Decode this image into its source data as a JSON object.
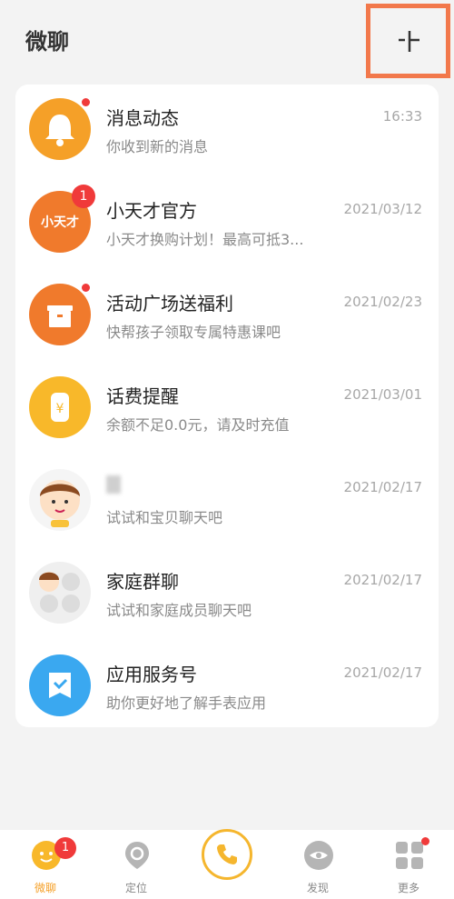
{
  "header": {
    "title": "微聊"
  },
  "messages": [
    {
      "name": "消息动态",
      "sub": "你收到新的消息",
      "time": "16:33",
      "icon": "bell-icon"
    },
    {
      "name": "小天才官方",
      "sub": "小天才换购计划！最高可抵3...",
      "time": "2021/03/12",
      "badge": "1",
      "avatar_text": "小天才",
      "icon": "xiaotiancai-logo"
    },
    {
      "name": "活动广场送福利",
      "sub": "快帮孩子领取专属特惠课吧",
      "time": "2021/02/23",
      "icon": "gift-icon"
    },
    {
      "name": "话费提醒",
      "sub": "余额不足0.0元，请及时充值",
      "time": "2021/03/01",
      "icon": "yuan-icon"
    },
    {
      "name": "",
      "sub": "试试和宝贝聊天吧",
      "time": "2021/02/17",
      "icon": "child-avatar"
    },
    {
      "name": "家庭群聊",
      "sub": "试试和家庭成员聊天吧",
      "time": "2021/02/17",
      "icon": "group-avatar"
    },
    {
      "name": "应用服务号",
      "sub": "助你更好地了解手表应用",
      "time": "2021/02/17",
      "icon": "service-icon"
    }
  ],
  "tabbar": {
    "tabs": [
      {
        "label": "微聊",
        "badge": "1",
        "icon": "chat-face-icon",
        "active": true
      },
      {
        "label": "定位",
        "icon": "location-icon"
      },
      {
        "label": "",
        "icon": "phone-icon"
      },
      {
        "label": "发现",
        "icon": "discover-eye-icon"
      },
      {
        "label": "更多",
        "icon": "more-grid-icon"
      }
    ]
  },
  "colors": {
    "orange": "#f5a028",
    "orange_red": "#f07a2c",
    "yellow": "#f8b82a",
    "blue": "#3aa8f0",
    "red": "#f03a3a",
    "highlight_box": "#f2784b"
  }
}
